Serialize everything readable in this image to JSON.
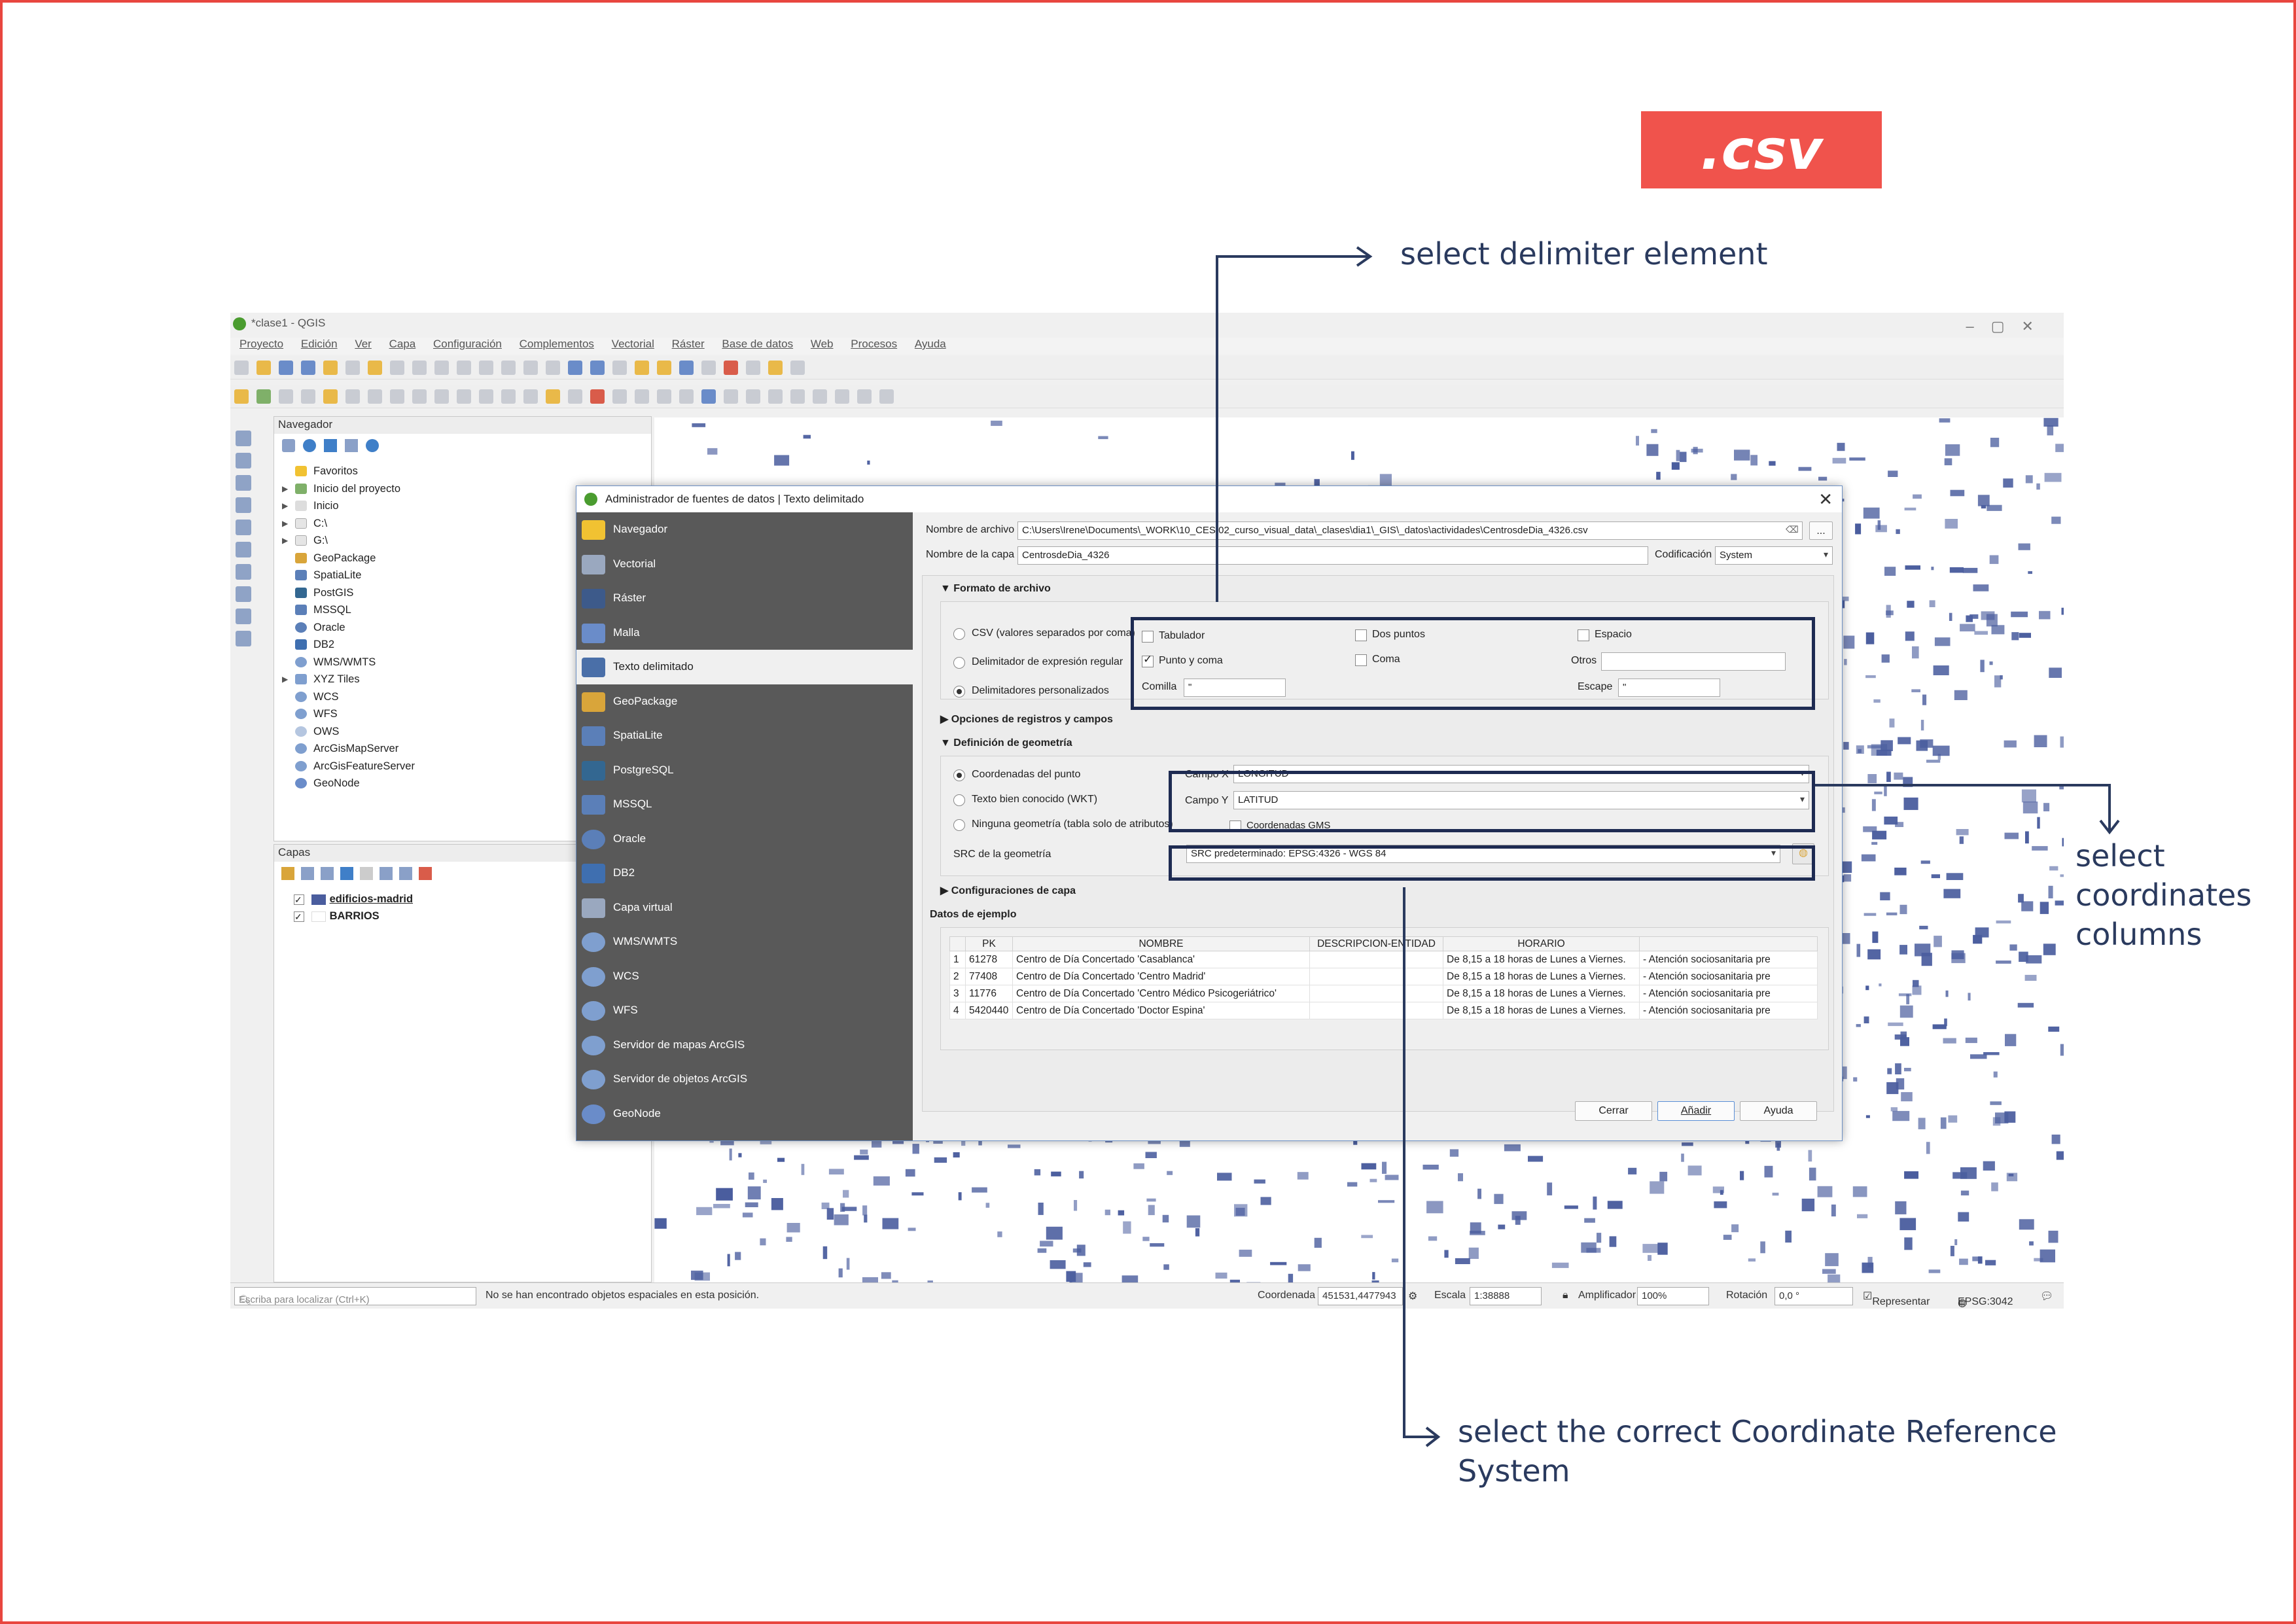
{
  "badge": ".csv",
  "annotations": {
    "delimiter": "select delimiter element",
    "coordinates": [
      "select",
      "coordinates",
      "columns"
    ],
    "crs": [
      "select the correct Coordinate Reference",
      "System"
    ]
  },
  "qgis": {
    "title": "*clase1 - QGIS",
    "menu": [
      "Proyecto",
      "Edición",
      "Ver",
      "Capa",
      "Configuración",
      "Complementos",
      "Vectorial",
      "Ráster",
      "Base de datos",
      "Web",
      "Procesos",
      "Ayuda"
    ],
    "browser": {
      "title": "Navegador",
      "items": [
        "Favoritos",
        "Inicio del proyecto",
        "Inicio",
        "C:\\",
        "G:\\",
        "GeoPackage",
        "SpatiaLite",
        "PostGIS",
        "MSSQL",
        "Oracle",
        "DB2",
        "WMS/WMTS",
        "XYZ Tiles",
        "WCS",
        "WFS",
        "OWS",
        "ArcGisMapServer",
        "ArcGisFeatureServer",
        "GeoNode"
      ]
    },
    "layers": {
      "title": "Capas",
      "items": [
        "edificios-madrid",
        "BARRIOS"
      ]
    },
    "status": {
      "search_placeholder": "Escriba para localizar (Ctrl+K)",
      "message": "No se han encontrado objetos espaciales en esta posición.",
      "coord_label": "Coordenada",
      "coord_value": "451531,4477943",
      "scale_label": "Escala",
      "scale_value": "1:38888",
      "magnifier_label": "Amplificador",
      "magnifier_value": "100%",
      "rotation_label": "Rotación",
      "rotation_value": "0,0 °",
      "render_label": "Representar",
      "epsg": "EPSG:3042"
    },
    "colors": {
      "map_buildings": "#4a5d9e",
      "dialog_sidebar": "#595959",
      "accent": "#f0534c"
    }
  },
  "dialog": {
    "title": "Administrador de fuentes de datos | Texto delimitado",
    "sidebar": [
      "Navegador",
      "Vectorial",
      "Ráster",
      "Malla",
      "Texto delimitado",
      "GeoPackage",
      "SpatiaLite",
      "PostgreSQL",
      "MSSQL",
      "Oracle",
      "DB2",
      "Capa virtual",
      "WMS/WMTS",
      "WCS",
      "WFS",
      "Servidor de mapas ArcGIS",
      "Servidor de objetos ArcGIS",
      "GeoNode"
    ],
    "file_label": "Nombre de archivo",
    "file_value": "C:\\Users\\Irene\\Documents\\_WORK\\10_CES\\02_curso_visual_data\\_clases\\dia1\\_GIS\\_datos\\actividades\\CentrosdeDia_4326.csv",
    "layer_label": "Nombre de la capa",
    "layer_value": "CentrosdeDia_4326",
    "encoding_label": "Codificación",
    "encoding_value": "System",
    "browse_btn": "...",
    "format": {
      "title": "Formato de archivo",
      "options": [
        "CSV (valores separados por coma)",
        "Delimitador de expresión regular",
        "Delimitadores personalizados"
      ],
      "delimiters": [
        "Tabulador",
        "Dos puntos",
        "Espacio",
        "Punto y coma",
        "Coma"
      ],
      "others_label": "Otros",
      "quote_label": "Comilla",
      "quote_value": "\"",
      "escape_label": "Escape",
      "escape_value": "\""
    },
    "records_section": "Opciones de registros y campos",
    "geometry": {
      "title": "Definición de geometría",
      "options": [
        "Coordenadas del punto",
        "Texto bien conocido (WKT)",
        "Ninguna geometría (tabla solo de atributos)"
      ],
      "x_label": "Campo X",
      "x_value": "LONGITUD",
      "y_label": "Campo Y",
      "y_value": "LATITUD",
      "dms_label": "Coordenadas GMS",
      "crs_label": "SRC de la geometría",
      "crs_value": "SRC predeterminado: EPSG:4326 - WGS 84"
    },
    "layer_config_section": "Configuraciones de capa",
    "sample": {
      "title": "Datos de ejemplo",
      "headers": [
        "",
        "PK",
        "NOMBRE",
        "DESCRIPCION-ENTIDAD",
        "HORARIO",
        ""
      ],
      "rows": [
        [
          "1",
          "61278",
          "Centro de Día Concertado 'Casablanca'",
          "",
          "De 8,15 a 18 horas de Lunes a Viernes.",
          "- Atención sociosanitaria pre"
        ],
        [
          "2",
          "77408",
          "Centro de Día Concertado 'Centro Madrid'",
          "",
          "De 8,15 a 18 horas de Lunes a Viernes.",
          "- Atención sociosanitaria pre"
        ],
        [
          "3",
          "11776",
          "Centro de Día Concertado 'Centro Médico Psicogeriátrico'",
          "",
          "De 8,15 a 18 horas de Lunes a Viernes.",
          "- Atención sociosanitaria pre"
        ],
        [
          "4",
          "5420440",
          "Centro de Día Concertado 'Doctor Espina'",
          "",
          "De 8,15 a 18 horas de Lunes a Viernes.",
          "- Atención sociosanitaria pre"
        ]
      ]
    },
    "buttons": {
      "close": "Cerrar",
      "add": "Añadir",
      "help": "Ayuda"
    }
  }
}
